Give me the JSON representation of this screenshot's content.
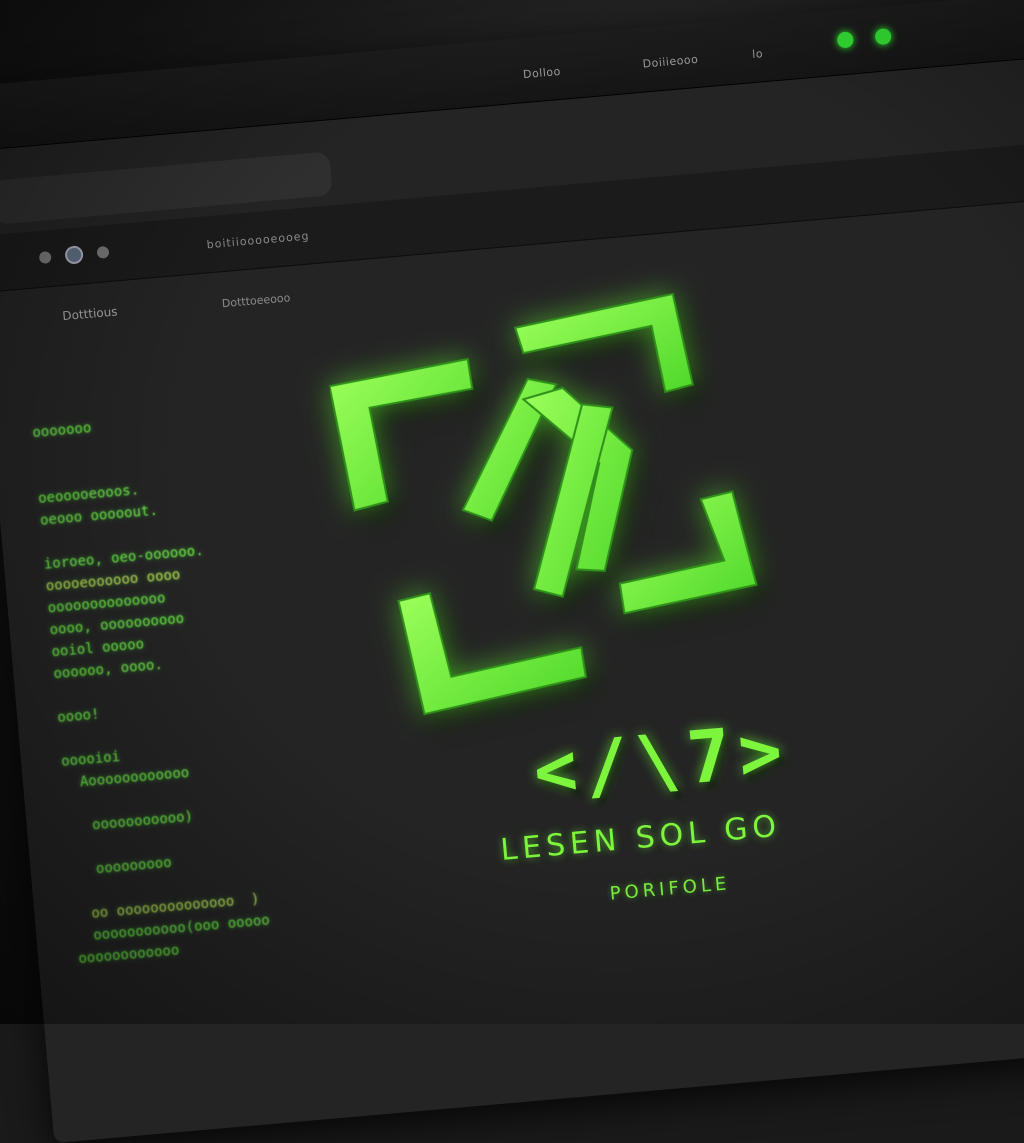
{
  "titlebar": {
    "menu_items": [
      "Dolloo",
      "Doiiieooo",
      "lo"
    ]
  },
  "tabs": {
    "title": "Dotttoeeooo"
  },
  "toolbar": {
    "url_label": "boitiiooooeooeg"
  },
  "sidebar": {
    "label": "Dotttious"
  },
  "code_lines": [
    "ooooooo",
    "",
    "",
    "oeooooeooos.",
    "oeooo ooooout.",
    "",
    "ioroeo, oeo-oooooo.",
    "ooooeoooooo oooo",
    "oooooooooooooo",
    "oooo, oooooooooo",
    "ooiol ooooo",
    "oooooo, oooo.",
    "",
    "oooo!",
    "",
    "ooooioi",
    "  Aoooooooooooo",
    "",
    "   ooooooooooo)",
    "",
    "   ooooooooo",
    "",
    "  oo oooooooooooooo  )",
    "  ooooooooooo(ooo ooooo",
    "oooooooooooo"
  ],
  "logo": {
    "glyphs": "</\\7>",
    "name": "LESEN SOL GO",
    "subtitle": "PORIFOLE",
    "icon": "code-brackets-icon"
  },
  "colors": {
    "accent": "#7cf53c",
    "background": "#242424",
    "titlebar": "#151515"
  }
}
